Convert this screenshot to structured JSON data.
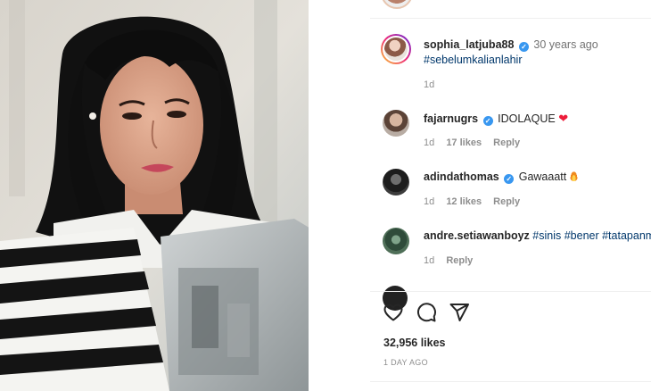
{
  "post": {
    "author": "sophia_latjuba88",
    "author_time": "30 years ago",
    "caption_tag": "#sebelumkalianlahir",
    "caption_age": "1d"
  },
  "comments": [
    {
      "user": "fajarnugrs",
      "verified": true,
      "text": "IDOLAQUE",
      "emoji": "heart",
      "age": "1d",
      "likes": "17 likes",
      "reply": "Reply"
    },
    {
      "user": "adindathomas",
      "verified": true,
      "text": "Gawaaatt",
      "emoji": "fire",
      "age": "1d",
      "likes": "12 likes",
      "reply": "Reply"
    },
    {
      "user": "andre.setiawanboyz",
      "verified": false,
      "text": "#sinis #bener #tatapanm",
      "age": "1d",
      "reply": "Reply"
    }
  ],
  "actions": {
    "icons": [
      "heart-icon",
      "comment-icon",
      "share-icon"
    ]
  },
  "stats": {
    "likes": "32,956 likes",
    "date": "1 DAY AGO"
  },
  "colors": {
    "link": "#00376b",
    "verified": "#3897f0",
    "muted": "#8e8e8e",
    "heart_emoji": "#ed1c3a"
  }
}
